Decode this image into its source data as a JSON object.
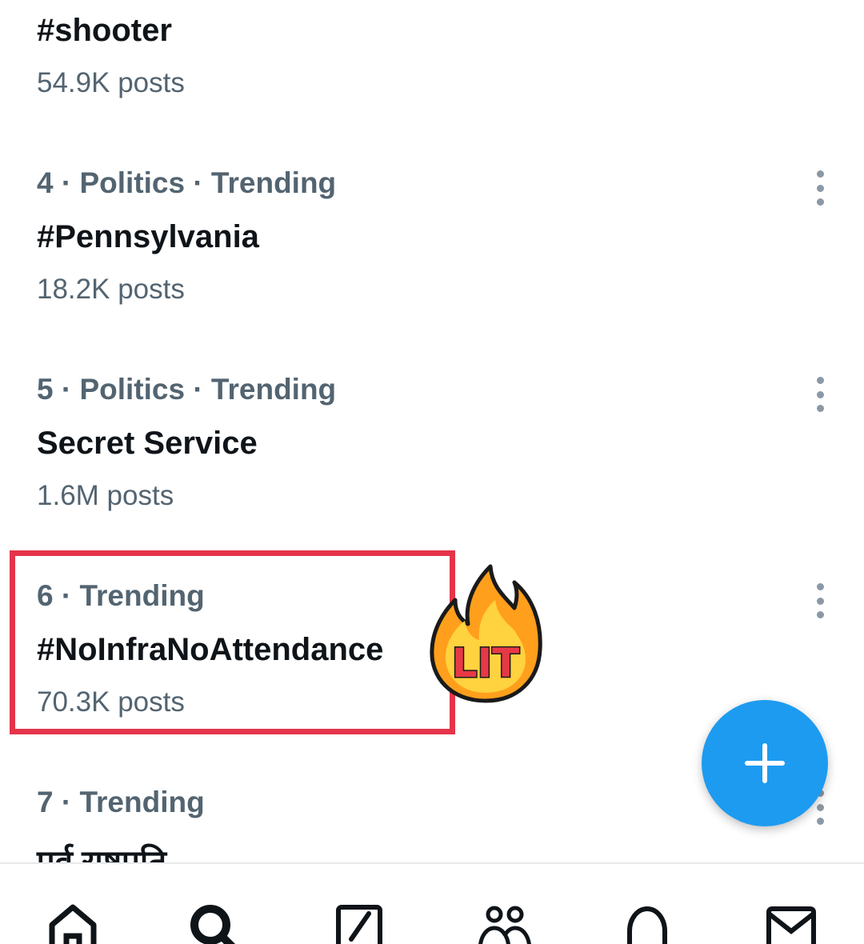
{
  "trends": [
    {
      "meta": "",
      "title": "#shooter",
      "posts": "54.9K posts",
      "has_more": false
    },
    {
      "meta": "4 · Politics · Trending",
      "title": "#Pennsylvania",
      "posts": "18.2K posts",
      "has_more": true
    },
    {
      "meta": "5 · Politics · Trending",
      "title": "Secret Service",
      "posts": "1.6M posts",
      "has_more": true
    },
    {
      "meta": "6 · Trending",
      "title": "#NoInfraNoAttendance",
      "posts": "70.3K posts",
      "has_more": true,
      "highlighted": true
    },
    {
      "meta": "7 · Trending",
      "title": "पूर्व राष्ट्रपति",
      "posts": "",
      "has_more": true
    }
  ],
  "sticker": {
    "text": "LIT",
    "icon": "fire-icon"
  },
  "fab": {
    "icon": "plus-icon",
    "color": "#1d9bf0"
  },
  "highlight_color": "#e5344a",
  "bottom_nav": [
    {
      "name": "home",
      "icon": "home-icon"
    },
    {
      "name": "search",
      "icon": "search-icon"
    },
    {
      "name": "grok",
      "icon": "grok-icon"
    },
    {
      "name": "communities",
      "icon": "communities-icon"
    },
    {
      "name": "notifications",
      "icon": "bell-icon"
    },
    {
      "name": "messages",
      "icon": "mail-icon"
    }
  ]
}
